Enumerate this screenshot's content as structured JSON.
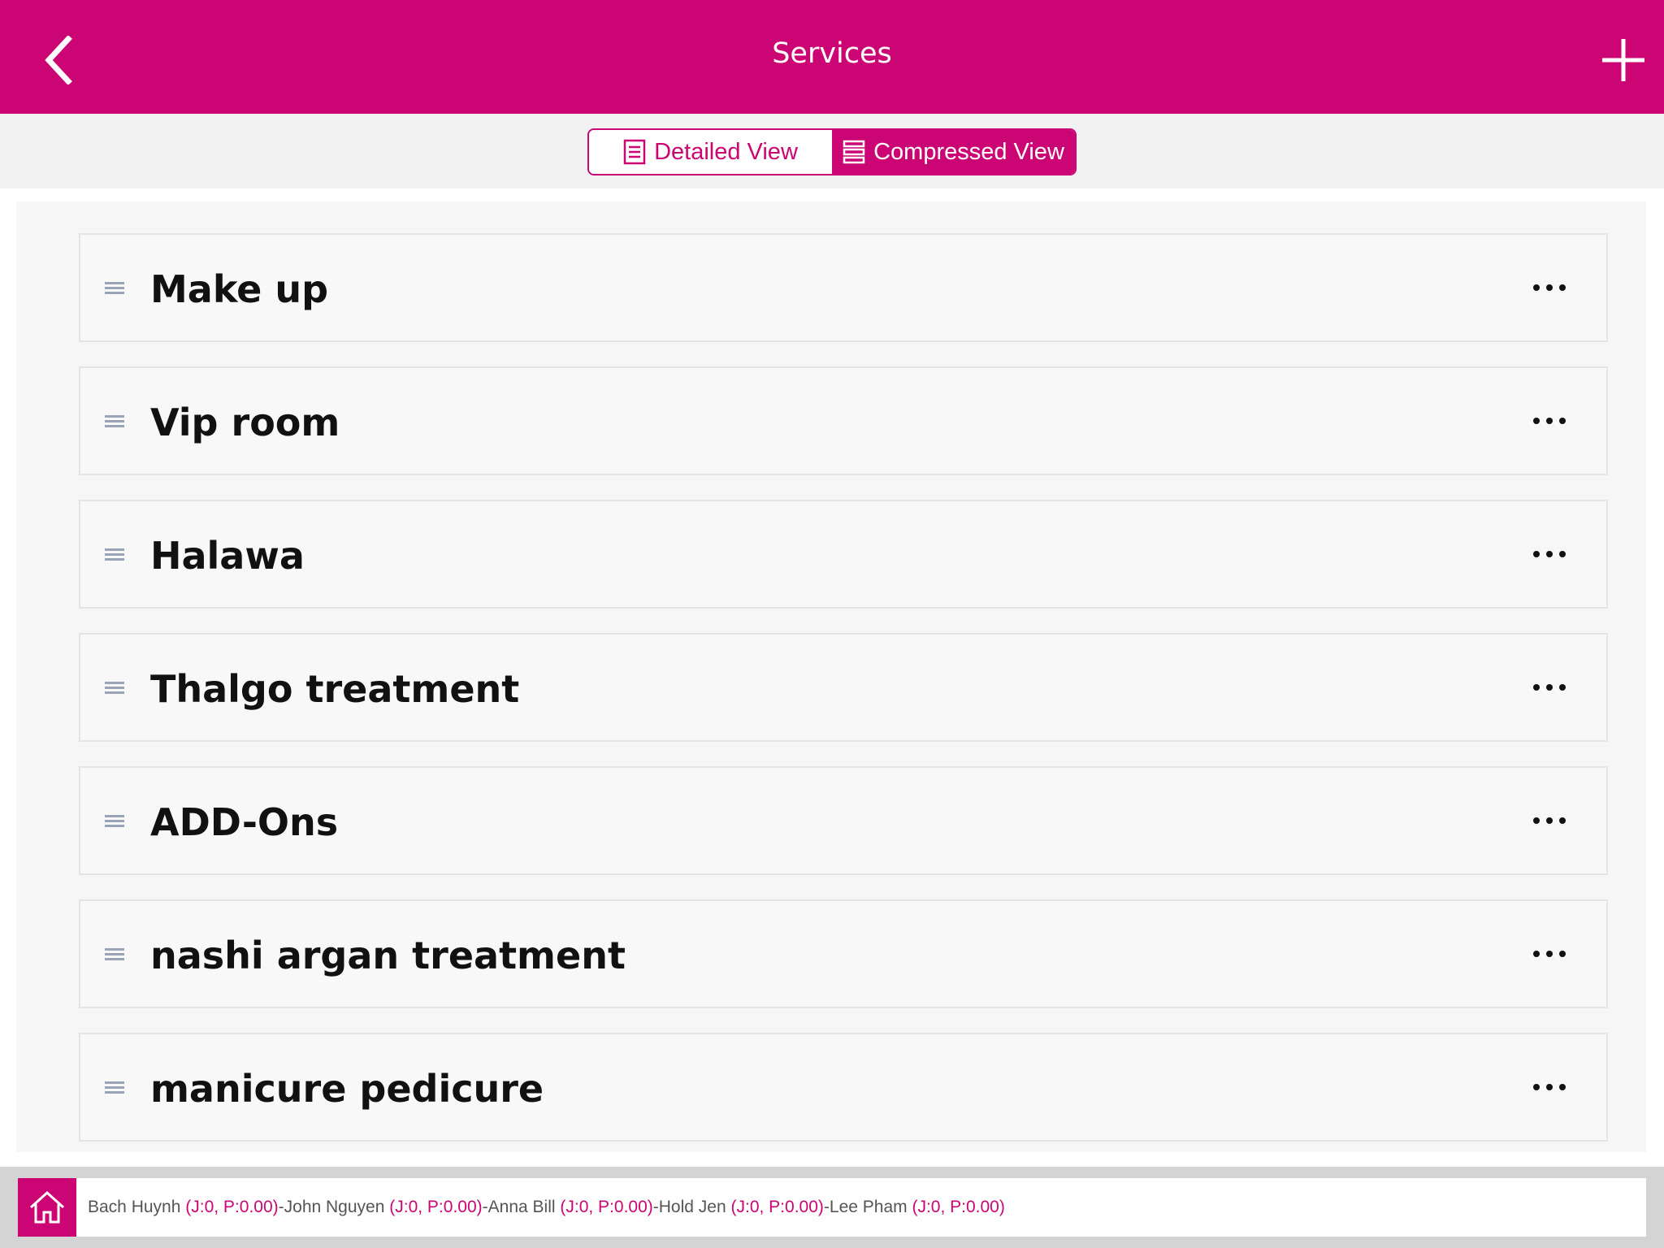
{
  "header": {
    "title": "Services",
    "back_icon": "chevron-left-icon",
    "add_icon": "plus-icon"
  },
  "view_toggle": {
    "detailed_label": "Detailed View",
    "compressed_label": "Compressed View",
    "selected": "Compressed View"
  },
  "services": [
    {
      "label": "Make up"
    },
    {
      "label": "Vip room"
    },
    {
      "label": "Halawa"
    },
    {
      "label": "Thalgo treatment"
    },
    {
      "label": "ADD-Ons"
    },
    {
      "label": "nashi argan treatment"
    },
    {
      "label": "manicure pedicure"
    }
  ],
  "footer": {
    "staff": [
      {
        "name": "Bach Huynh",
        "stats": "(J:0, P:0.00)"
      },
      {
        "name": "John Nguyen",
        "stats": "(J:0, P:0.00)"
      },
      {
        "name": "Anna Bill",
        "stats": "(J:0, P:0.00)"
      },
      {
        "name": "Hold Jen",
        "stats": "(J:0, P:0.00)"
      },
      {
        "name": "Lee Pham",
        "stats": "(J:0, P:0.00)"
      }
    ],
    "separator": " - "
  },
  "colors": {
    "accent": "#cc0574",
    "row_bg": "#f8f8f8",
    "footer_bg": "#d4d4d4"
  }
}
